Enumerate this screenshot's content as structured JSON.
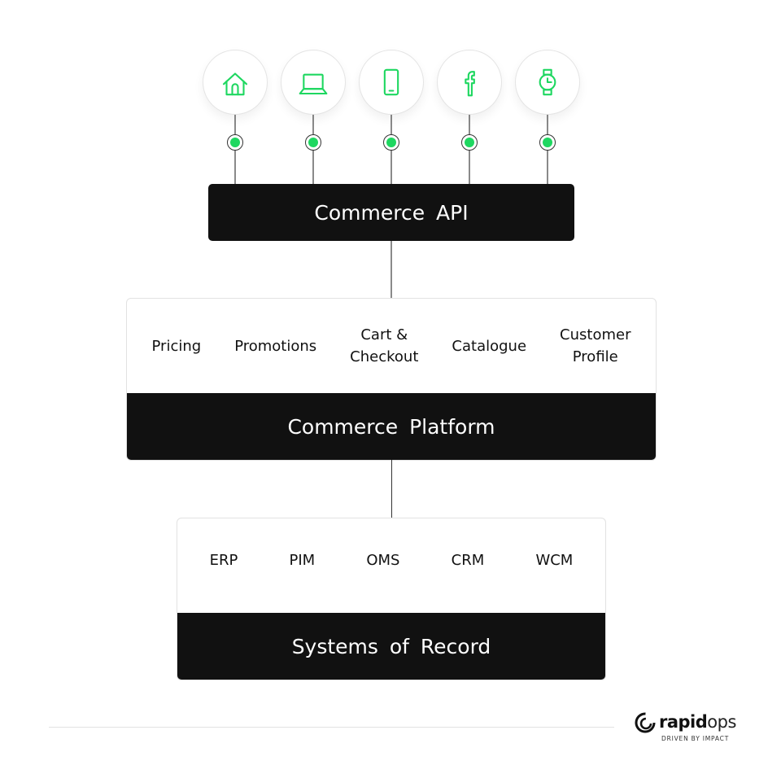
{
  "channels": [
    {
      "icon": "home-icon"
    },
    {
      "icon": "laptop-icon"
    },
    {
      "icon": "mobile-icon"
    },
    {
      "icon": "facebook-icon"
    },
    {
      "icon": "smartwatch-icon"
    }
  ],
  "colors": {
    "accent": "#1ed760",
    "dark": "#111111"
  },
  "api": {
    "title": "Commerce API"
  },
  "platform": {
    "title": "Commerce Platform",
    "modules": [
      "Pricing",
      "Promotions",
      "Cart &\nCheckout",
      "Catalogue",
      "Customer\nProfile"
    ]
  },
  "records": {
    "title": "Systems of Record",
    "systems": [
      "ERP",
      "PIM",
      "OMS",
      "CRM",
      "WCM"
    ]
  },
  "logo": {
    "name_bold": "rapid",
    "name_light": "ops",
    "tagline": "DRIVEN BY IMPACT"
  }
}
